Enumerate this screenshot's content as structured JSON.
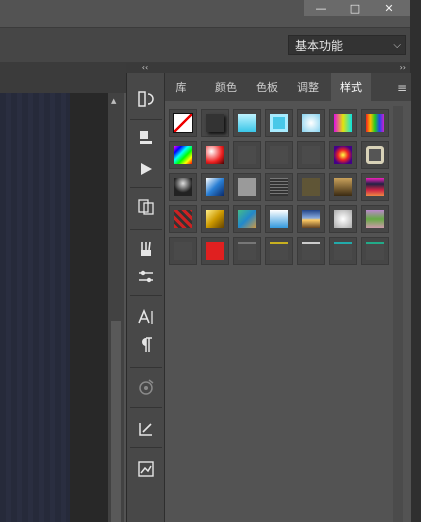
{
  "window": {
    "minimize": "—",
    "maximize": "□",
    "close": "✕"
  },
  "options": {
    "workspace": "基本功能"
  },
  "dock": {
    "collapse_arrows": "‹‹",
    "expand_arrows": "››"
  },
  "panel": {
    "tabs": [
      "库",
      "颜色",
      "色板",
      "调整",
      "样式"
    ],
    "active_tab": "样式",
    "menu_icon": "hamburger-icon"
  },
  "styles": {
    "swatches": [
      {
        "style": "none"
      },
      {
        "style": "shadow-gray"
      },
      {
        "style": "cyan-glass"
      },
      {
        "style": "cyan-frame"
      },
      {
        "style": "sky-spark"
      },
      {
        "style": "spectrum-fade"
      },
      {
        "style": "rainbow-stripes"
      },
      {
        "style": "rainbow-gradient"
      },
      {
        "style": "red-glow"
      },
      {
        "style": "flat-gray"
      },
      {
        "style": "flat-gray"
      },
      {
        "style": "flat-gray"
      },
      {
        "style": "purple-burst"
      },
      {
        "style": "beige-ring"
      },
      {
        "style": "chrome-black"
      },
      {
        "style": "blue-chrome"
      },
      {
        "style": "silver"
      },
      {
        "style": "dark-texture"
      },
      {
        "style": "olive"
      },
      {
        "style": "bronze-gradient"
      },
      {
        "style": "sunset-stripes"
      },
      {
        "style": "red-mosaic"
      },
      {
        "style": "gold"
      },
      {
        "style": "blue-mosaic"
      },
      {
        "style": "sky-gradient"
      },
      {
        "style": "sunset-horizon"
      },
      {
        "style": "white-glass"
      },
      {
        "style": "purple-gold"
      },
      {
        "style": "empty-dark"
      },
      {
        "style": "red-fill"
      },
      {
        "style": "gray-line"
      },
      {
        "style": "yellow-line"
      },
      {
        "style": "white-line"
      },
      {
        "style": "teal-line"
      },
      {
        "style": "green-line"
      }
    ]
  }
}
